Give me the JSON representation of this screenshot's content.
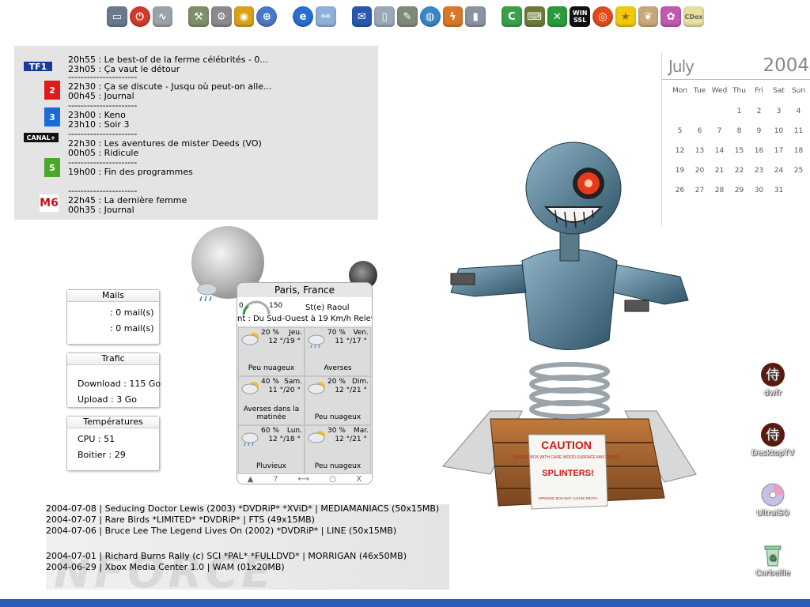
{
  "toolbar": {
    "icons": [
      "drive-icon",
      "power-icon",
      "cable-icon",
      "network-tools-icon",
      "tools-icon",
      "nero-icon",
      "browser-icon",
      "ie-icon",
      "connection-icon",
      "outlook-icon",
      "device-icon",
      "pen-icon",
      "globe-icon",
      "lightning-icon",
      "phone-icon",
      "ccleaner-icon",
      "keyboard-icon",
      "x-icon",
      "winssl-icon",
      "burn-icon",
      "star-icon",
      "rabbit-icon",
      "paint-icon",
      "cdex-icon"
    ],
    "winssl_label": "WIN SSL",
    "cdex_label": "CDex"
  },
  "tv": {
    "channels": [
      {
        "name": "TF1",
        "lines": [
          "20h55 : Le best-of de la ferme célébrités - 0...",
          "23h05 : Ça vaut le détour"
        ]
      },
      {
        "name": "2",
        "lines": [
          "22h30 : Ça se discute - Jusqu où peut-on alle...",
          "00h45 : Journal"
        ]
      },
      {
        "name": "3",
        "lines": [
          "23h00 : Keno",
          "23h10 : Soir 3"
        ]
      },
      {
        "name": "CANAL+",
        "lines": [
          "22h30 : Les aventures de mister Deeds (VO)",
          "00h05 : Ridicule"
        ]
      },
      {
        "name": "5",
        "lines": [
          "19h00 : Fin des programmes",
          ""
        ]
      },
      {
        "name": "M6",
        "lines": [
          "22h45 : La dernière femme",
          "00h35 : Journal"
        ]
      }
    ],
    "separator": "----------------------"
  },
  "calendar": {
    "month": "July",
    "year": "2004",
    "weekdays": [
      "Mon",
      "Tue",
      "Wed",
      "Thu",
      "Fri",
      "Sat",
      "Sun"
    ],
    "weeks": [
      [
        "",
        "",
        "",
        "1",
        "2",
        "3",
        "4"
      ],
      [
        "5",
        "6",
        "7",
        "8",
        "9",
        "10",
        "11"
      ],
      [
        "12",
        "13",
        "14",
        "15",
        "16",
        "17",
        "18"
      ],
      [
        "19",
        "20",
        "21",
        "22",
        "23",
        "24",
        "25"
      ],
      [
        "26",
        "27",
        "28",
        "29",
        "30",
        "31",
        ""
      ]
    ]
  },
  "mails": {
    "title": "Mails",
    "lines": [
      ": 0 mail(s)",
      ": 0 mail(s)"
    ]
  },
  "trafic": {
    "title": "Trafic",
    "download": "Download : 115 Go",
    "upload": "Upload : 3 Go"
  },
  "temps": {
    "title": "Températures",
    "cpu": "CPU : 51",
    "boitier": "Boitier : 29"
  },
  "weather": {
    "city": "Paris, France",
    "gauge_min": "0",
    "gauge_max": "150",
    "saint": "St(e) Raoul",
    "wind": "nt : Du Sud-Ouest à 19 Km/h Relev",
    "days": [
      {
        "pct": "20 %",
        "day": "Jeu.",
        "temp": "12 °/19 °",
        "cond": "Peu nuageux",
        "icon": "partly-cloudy-icon"
      },
      {
        "pct": "70 %",
        "day": "Ven.",
        "temp": "11 °/17 °",
        "cond": "Averses",
        "icon": "rain-icon"
      },
      {
        "pct": "40 %",
        "day": "Sam.",
        "temp": "11 °/20 °",
        "cond": "Averses dans la matinée",
        "icon": "partly-cloudy-icon"
      },
      {
        "pct": "20 %",
        "day": "Dim.",
        "temp": "12 °/21 °",
        "cond": "Peu nuageux",
        "icon": "partly-cloudy-icon"
      },
      {
        "pct": "60 %",
        "day": "Lun.",
        "temp": "12 °/18 °",
        "cond": "Pluvieux",
        "icon": "rain-icon"
      },
      {
        "pct": "30 %",
        "day": "Mar.",
        "temp": "12 °/21 °",
        "cond": "Peu nuageux",
        "icon": "partly-cloudy-icon"
      }
    ],
    "bar_glyphs": [
      "▲",
      "?",
      "⟷",
      "○",
      "X"
    ]
  },
  "releases": [
    "2004-07-08 | Seducing Doctor Lewis (2003) *DVDRiP* *XViD* | MEDIAMANIACS (50x15MB)",
    "2004-07-07 | Rare Birds *LIMITED* *DVDRiP* | FTS (49x15MB)",
    "2004-07-06 | Bruce Lee The Legend Lives On (2002) *DVDRiP* | LINE (50x15MB)",
    "",
    "2004-07-01 | Richard Burns Rally (c) SCI *PAL* *FULLDVD* | MORRIGAN (46x50MB)",
    "2004-06-29 | Xbox Media Center 1.0 | WAM (01x20MB)"
  ],
  "watermark": "NFORCE",
  "robot": {
    "caution": "CAUTION",
    "warning": "HANDLE BOX WITH CARE WOOD SURFACE MAY CAUSE...",
    "splinters": "SPLINTERS!",
    "footer": "OPENING BOX MAY CAUSE DEATH"
  },
  "desktop_icons": [
    {
      "label": "dwfr",
      "icon": "samurai-kanji-icon"
    },
    {
      "label": "DesktopTV",
      "icon": "samurai-kanji-icon"
    },
    {
      "label": "UltraISO",
      "icon": "disc-icon"
    },
    {
      "label": "Corbeille",
      "icon": "recycle-bin-icon"
    }
  ],
  "kanji": "侍"
}
